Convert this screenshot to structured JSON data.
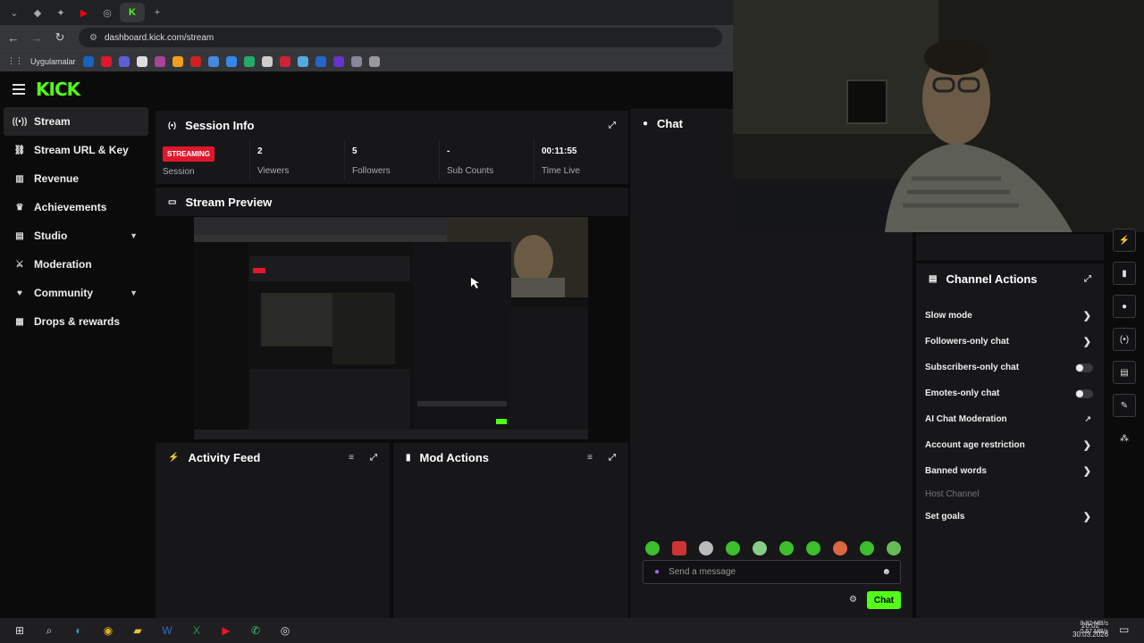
{
  "browser": {
    "url": "dashboard.kick.com/stream",
    "bookmarks_label": "Uygulamalar"
  },
  "brand": {
    "logo": "KICK",
    "accent": "#53fc18"
  },
  "sidebar": {
    "items": [
      {
        "label": "Stream",
        "icon": "stream-icon",
        "active": true
      },
      {
        "label": "Stream URL & Key",
        "icon": "link-icon"
      },
      {
        "label": "Revenue",
        "icon": "revenue-icon"
      },
      {
        "label": "Achievements",
        "icon": "trophy-icon"
      },
      {
        "label": "Studio",
        "icon": "studio-icon",
        "expandable": true
      },
      {
        "label": "Moderation",
        "icon": "sword-icon"
      },
      {
        "label": "Community",
        "icon": "community-icon",
        "expandable": true
      },
      {
        "label": "Drops & rewards",
        "icon": "gift-icon"
      }
    ]
  },
  "session": {
    "title": "Session Info",
    "status": "STREAMING",
    "status_label": "Session",
    "viewers": {
      "value": "2",
      "label": "Viewers"
    },
    "followers": {
      "value": "5",
      "label": "Followers"
    },
    "subs": {
      "value": "-",
      "label": "Sub Counts"
    },
    "time": {
      "value": "00:11:55",
      "label": "Time Live"
    }
  },
  "preview": {
    "title": "Stream Preview"
  },
  "activity": {
    "title": "Activity Feed"
  },
  "mod": {
    "title": "Mod Actions"
  },
  "chat": {
    "title": "Chat",
    "placeholder": "Send a message",
    "send_label": "Chat"
  },
  "actions": {
    "title": "Channel Actions",
    "items": [
      {
        "label": "Slow mode",
        "kind": "arrow"
      },
      {
        "label": "Followers-only chat",
        "kind": "arrow"
      },
      {
        "label": "Subscribers-only chat",
        "kind": "toggle",
        "on": false
      },
      {
        "label": "Emotes-only chat",
        "kind": "toggle",
        "on": false
      },
      {
        "label": "AI Chat Moderation",
        "kind": "external"
      },
      {
        "label": "Account age restriction",
        "kind": "arrow"
      },
      {
        "label": "Banned words",
        "kind": "arrow"
      },
      {
        "label": "Host Channel",
        "kind": "disabled"
      },
      {
        "label": "Set goals",
        "kind": "arrow"
      }
    ]
  },
  "tray": {
    "net_up": "0.82 MB/s",
    "net_down": "0.67 MB/s",
    "time": "20:02",
    "date": "30.03.2026"
  }
}
